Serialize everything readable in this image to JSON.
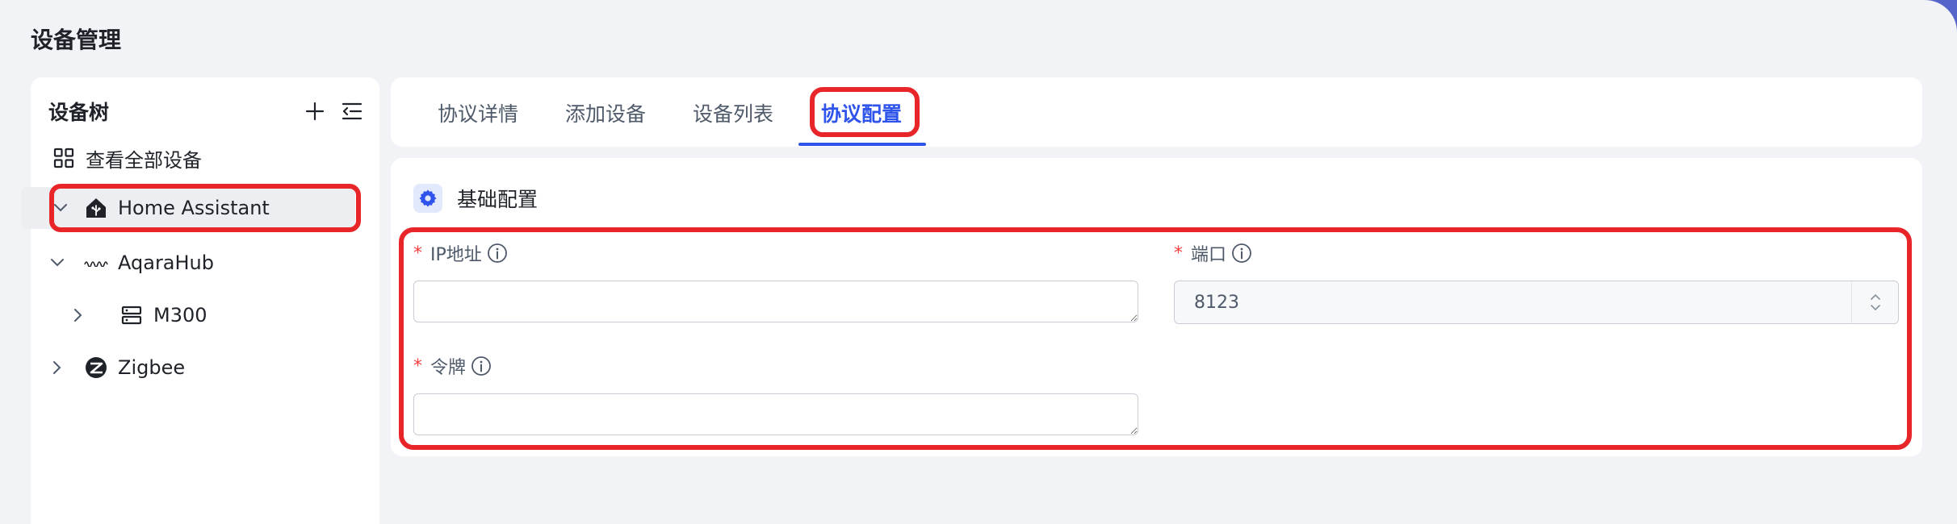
{
  "page": {
    "title": "设备管理"
  },
  "tree": {
    "title": "设备树",
    "items": [
      {
        "label": "查看全部设备",
        "icon": "grid-icon"
      },
      {
        "label": "Home Assistant",
        "icon": "home-assistant-icon",
        "expanded": true,
        "selected": true
      },
      {
        "label": "AqaraHub",
        "icon": "aqara-logo-icon",
        "expanded": true
      },
      {
        "label": "M300",
        "icon": "server-icon",
        "expanded": false
      },
      {
        "label": "Zigbee",
        "icon": "zigbee-logo-icon",
        "expanded": false
      }
    ]
  },
  "tabs": [
    {
      "label": "协议详情",
      "active": false
    },
    {
      "label": "添加设备",
      "active": false
    },
    {
      "label": "设备列表",
      "active": false
    },
    {
      "label": "协议配置",
      "active": true
    }
  ],
  "config": {
    "section_title": "基础配置",
    "fields": {
      "ip": {
        "label": "IP地址",
        "value": ""
      },
      "port": {
        "label": "端口",
        "value": "8123"
      },
      "token": {
        "label": "令牌",
        "value": ""
      }
    }
  },
  "colors": {
    "accent": "#2f54eb",
    "highlight": "#e8262a",
    "required": "#f53f3f"
  }
}
